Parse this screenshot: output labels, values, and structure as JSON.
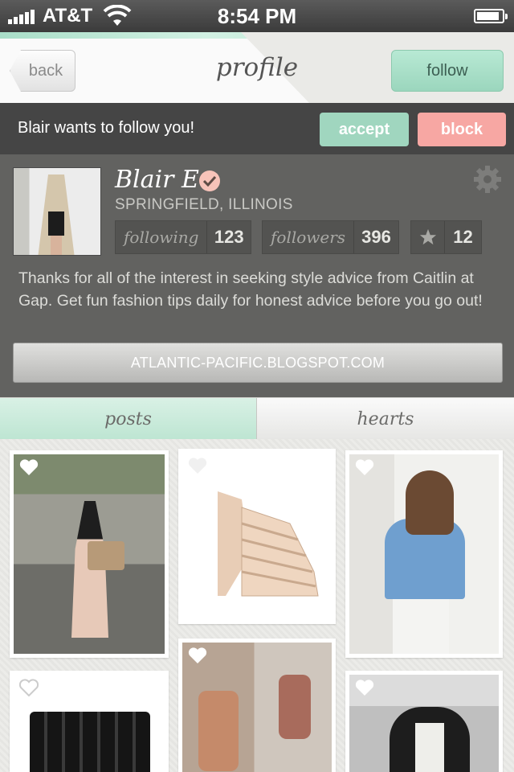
{
  "status_bar": {
    "carrier": "AT&T",
    "time": "8:54 PM",
    "signal_bars": 5,
    "battery_level": 0.9,
    "icons": [
      "signal-icon",
      "wifi-icon",
      "battery-icon"
    ]
  },
  "nav": {
    "back_label": "back",
    "title": "profile",
    "follow_label": "follow"
  },
  "follow_request": {
    "message": "Blair wants to follow you!",
    "accept_label": "accept",
    "block_label": "block"
  },
  "profile": {
    "name": "Blair E.",
    "location": "SPRINGFIELD, ILLINOIS",
    "stats": {
      "following_label": "following",
      "following_count": "123",
      "followers_label": "followers",
      "followers_count": "396",
      "stars_count": "12"
    },
    "bio": "Thanks for all of the interest in seeking style advice from Caitlin at Gap. Get fun fashion tips daily for honest advice before you go out!",
    "blog_url": "ATLANTIC-PACIFIC.BLOGSPOT.COM"
  },
  "tabs": {
    "posts_label": "posts",
    "hearts_label": "hearts",
    "active": "posts"
  },
  "colors": {
    "accent_mint": "#a0d6bf",
    "block_pink": "#f7a7a3",
    "profile_bg": "#626260",
    "request_bg": "#454545"
  }
}
